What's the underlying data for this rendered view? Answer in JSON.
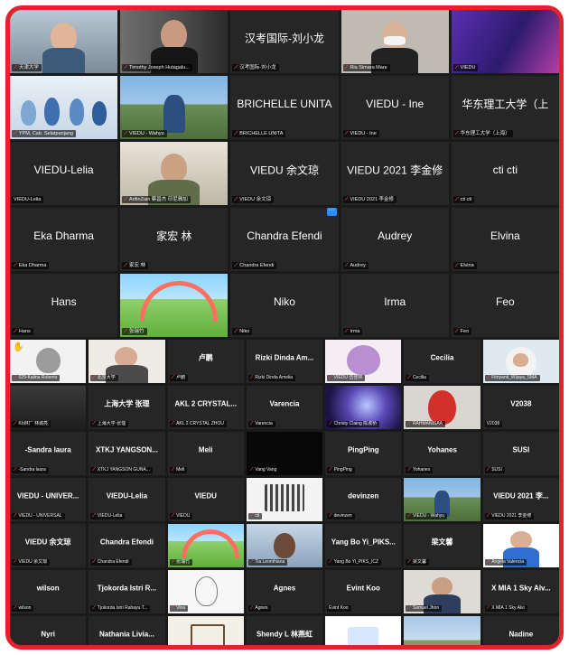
{
  "big_rows": [
    [
      {
        "label": "天津大学",
        "kind": "photo-man",
        "selected": true
      },
      {
        "label": "Timothy Joseph Hutagalu...",
        "kind": "photo-man2"
      },
      {
        "name": "汉考国际-刘小龙",
        "label": "汉考国际-刘小龙"
      },
      {
        "label": "Ria Simara Mare",
        "kind": "photo-woman"
      },
      {
        "label": "VIEDU",
        "kind": "photo-banner"
      }
    ],
    [
      {
        "label": "YPM, Cab. Selatpanjang",
        "kind": "photo-class",
        "selected": true
      },
      {
        "label": "VIEDU - Wahyu",
        "kind": "photo-outdoor"
      },
      {
        "name": "BRICHELLE UNITA",
        "label": "BRICHELLE UNITA"
      },
      {
        "name": "VIEDU - Ine",
        "label": "VIEDU - Ine"
      },
      {
        "name": "华东理工大学（上",
        "label": "华东理工大学（上海）"
      }
    ],
    [
      {
        "name": "VIEDU-Lelia",
        "label": "VIEDU-Lelia",
        "plain_label": true
      },
      {
        "label": "ArifinZain 蔡昌杰 印尼雅加",
        "kind": "photo-oldman"
      },
      {
        "name": "VIEDU 余文琼",
        "label": "VIEDU 余文琼"
      },
      {
        "name": "VIEDU 2021 李金修",
        "label": "VIEDU 2021 李金修"
      },
      {
        "name": "cti cti",
        "label": "cti cti"
      }
    ],
    [
      {
        "name": "Eka Dharma",
        "label": "Eka Dharma"
      },
      {
        "name": "家宏 林",
        "label": "家宏 林"
      },
      {
        "name": "Chandra Efendi",
        "label": "Chandra Efendi",
        "badge": true
      },
      {
        "name": "Audrey",
        "label": "Audrey"
      },
      {
        "name": "Elvina",
        "label": "Elvina"
      }
    ],
    [
      {
        "name": "Hans",
        "label": "Hans"
      },
      {
        "label": "张瑞竹",
        "kind": "photo-rainbow"
      },
      {
        "name": "Niko",
        "label": "Niko"
      },
      {
        "name": "Irma",
        "label": "Irma"
      },
      {
        "name": "Feo",
        "label": "Feo"
      }
    ]
  ],
  "small_rows": [
    [
      {
        "label": "029-Kalina Roberts",
        "kind": "photo-knight",
        "hand": true
      },
      {
        "label": "北京大学",
        "kind": "photo-woman2"
      },
      {
        "name": "卢鹏",
        "label": "卢鹏"
      },
      {
        "name": "Rizki Dinda Am...",
        "label": "Rizki Dinda Amelia"
      },
      {
        "label": "VIEDU 伍佳林",
        "kind": "photo-anime"
      },
      {
        "name": "Cecilia",
        "label": "Cecilia"
      },
      {
        "label": "Fitriyanti_Wijaya_SMA",
        "kind": "photo-hijab"
      }
    ],
    [
      {
        "label": "Kh林厂 林城亮",
        "kind": "photo-dark"
      },
      {
        "name": "上海大学 张理",
        "label": "上海大学 张理"
      },
      {
        "name": "AKL 2 CRYSTAL...",
        "label": "AKL 2 CRYSTAL ZHOU"
      },
      {
        "name": "Varencia",
        "label": "Varencia"
      },
      {
        "label": "Christy Claing 陈淑桥",
        "kind": "photo-galaxy"
      },
      {
        "label": "RAHMANISAA",
        "kind": "photo-redboy"
      },
      {
        "name": "V2038",
        "label": "V2038",
        "plain_label": true
      }
    ],
    [
      {
        "name": "-Sandra laura",
        "label": "-Sandra laura"
      },
      {
        "name": "XTKJ YANGSON...",
        "label": "XTKJ YANGSON GUNA..."
      },
      {
        "name": "Meli",
        "label": "Meli"
      },
      {
        "label": "Vang Vang",
        "kind": "photo-black"
      },
      {
        "name": "PingPing",
        "label": "PingPing"
      },
      {
        "name": "Yohanes",
        "label": "Yohanes"
      },
      {
        "name": "SUSI",
        "label": "SUSI"
      }
    ],
    [
      {
        "name": "VIEDU - UNIVER...",
        "label": "VIEDU - UNIVERSAL"
      },
      {
        "name": "VIEDU-Lelia",
        "label": "VIEDU-Lelia"
      },
      {
        "name": "VIEDU",
        "label": "VIEDU"
      },
      {
        "label": "cti",
        "kind": "photo-qr"
      },
      {
        "name": "devinzen",
        "label": "devinzen"
      },
      {
        "label": "VIEDU - Wahyu",
        "kind": "photo-outdoor"
      },
      {
        "name": "VIEDU 2021 李...",
        "label": "VIEDU 2021 李金修"
      }
    ],
    [
      {
        "name": "VIEDU 余文琼",
        "label": "VIEDU 余文琼"
      },
      {
        "name": "Chandra Efendi",
        "label": "Chandra Efendi"
      },
      {
        "label": "张瑞竹",
        "kind": "photo-rainbow"
      },
      {
        "label": "Tia Leonthiana",
        "kind": "photo-tree"
      },
      {
        "name": "Yang Bo Yi_PIKS...",
        "label": "Yang Bo Yi_PIKS_ICZ"
      },
      {
        "name": "梁文馨",
        "label": "梁文馨"
      },
      {
        "label": "Angela Valencia",
        "kind": "photo-idboy"
      }
    ],
    [
      {
        "name": "wilson",
        "label": "wilson"
      },
      {
        "name": "Tjokorda Istri R...",
        "label": "Tjokorda Istri Rahayu T..."
      },
      {
        "label": "Vina",
        "kind": "photo-sketch"
      },
      {
        "name": "Agnes",
        "label": "Agnes"
      },
      {
        "name": "Evint Koo",
        "label": "Evint Koo",
        "plain_label": true
      },
      {
        "label": "Samuel Jhon",
        "kind": "photo-boy"
      },
      {
        "name": "X MIA 1 Sky Alv...",
        "label": "X MIA 1 Sky Alvi"
      }
    ],
    [
      {
        "name": "Nyri",
        "label": ""
      },
      {
        "name": "Nathania Livia...",
        "label": ""
      },
      {
        "label": "",
        "kind": "photo-temple"
      },
      {
        "name": "Shendy L 林燕虹",
        "label": ""
      },
      {
        "label": "",
        "kind": "photo-qr2"
      },
      {
        "label": "",
        "kind": "photo-field"
      },
      {
        "name": "Nadine",
        "label": ""
      }
    ]
  ],
  "icons": {
    "mic_muted": "mic-muted-icon",
    "raise_hand": "raise-hand-icon"
  },
  "colors": {
    "frame": "#e0232c",
    "tile": "#262626",
    "active_speaker": "#e3402c",
    "muted": "#ff4b4b"
  }
}
